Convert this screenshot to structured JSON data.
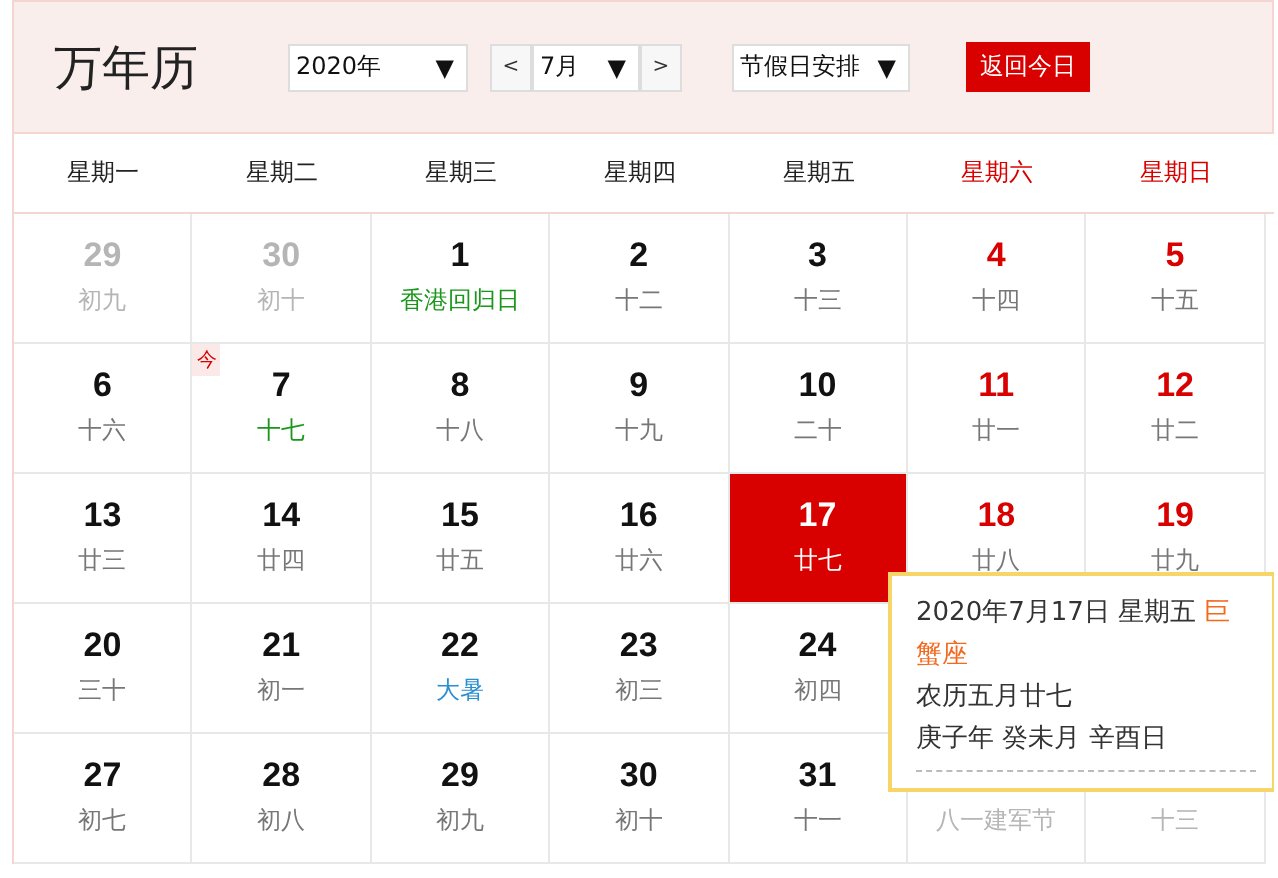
{
  "header": {
    "title": "万年历",
    "year_select": "2020年",
    "prev": "<",
    "month_select": "7月",
    "next": ">",
    "holiday_select": "节假日安排",
    "today_button": "返回今日",
    "caret": "▼"
  },
  "weekdays": [
    {
      "label": "星期一",
      "weekend": false
    },
    {
      "label": "星期二",
      "weekend": false
    },
    {
      "label": "星期三",
      "weekend": false
    },
    {
      "label": "星期四",
      "weekend": false
    },
    {
      "label": "星期五",
      "weekend": false
    },
    {
      "label": "星期六",
      "weekend": true
    },
    {
      "label": "星期日",
      "weekend": true
    }
  ],
  "weeks": [
    [
      {
        "day": "29",
        "sub": "初九",
        "other_month": true,
        "selected": false
      },
      {
        "day": "30",
        "sub": "初十",
        "other_month": true,
        "selected": false
      },
      {
        "day": "1",
        "sub": "香港回归日",
        "kind": "festival",
        "other_month": false,
        "weekend": false,
        "selected": false
      },
      {
        "day": "2",
        "sub": "十二",
        "kind": "lunar",
        "other_month": false,
        "weekend": false,
        "selected": false
      },
      {
        "day": "3",
        "sub": "十三",
        "kind": "lunar",
        "other_month": false,
        "weekend": false,
        "selected": false
      },
      {
        "day": "4",
        "sub": "十四",
        "kind": "lunar",
        "other_month": false,
        "weekend": true,
        "selected": false
      },
      {
        "day": "5",
        "sub": "十五",
        "kind": "lunar",
        "other_month": false,
        "weekend": true,
        "selected": false
      }
    ],
    [
      {
        "day": "6",
        "sub": "十六",
        "kind": "lunar",
        "other_month": false,
        "weekend": false,
        "selected": false
      },
      {
        "day": "7",
        "sub": "十七",
        "kind": "lunar",
        "other_month": false,
        "weekend": false,
        "today": true,
        "badge": "今",
        "selected": false
      },
      {
        "day": "8",
        "sub": "十八",
        "kind": "lunar",
        "other_month": false,
        "weekend": false,
        "selected": false
      },
      {
        "day": "9",
        "sub": "十九",
        "kind": "lunar",
        "other_month": false,
        "weekend": false,
        "selected": false
      },
      {
        "day": "10",
        "sub": "二十",
        "kind": "lunar",
        "other_month": false,
        "weekend": false,
        "selected": false
      },
      {
        "day": "11",
        "sub": "廿一",
        "kind": "lunar",
        "other_month": false,
        "weekend": true,
        "selected": false
      },
      {
        "day": "12",
        "sub": "廿二",
        "kind": "lunar",
        "other_month": false,
        "weekend": true,
        "selected": false
      }
    ],
    [
      {
        "day": "13",
        "sub": "廿三",
        "kind": "lunar",
        "other_month": false,
        "weekend": false,
        "selected": false
      },
      {
        "day": "14",
        "sub": "廿四",
        "kind": "lunar",
        "other_month": false,
        "weekend": false,
        "selected": false
      },
      {
        "day": "15",
        "sub": "廿五",
        "kind": "lunar",
        "other_month": false,
        "weekend": false,
        "selected": false
      },
      {
        "day": "16",
        "sub": "廿六",
        "kind": "lunar",
        "other_month": false,
        "weekend": false,
        "selected": false
      },
      {
        "day": "17",
        "sub": "廿七",
        "selected": true
      },
      {
        "day": "18",
        "sub": "廿八",
        "kind": "lunar",
        "other_month": false,
        "weekend": true,
        "selected": false
      },
      {
        "day": "19",
        "sub": "廿九",
        "kind": "lunar",
        "other_month": false,
        "weekend": true,
        "selected": false
      }
    ],
    [
      {
        "day": "20",
        "sub": "三十",
        "kind": "lunar",
        "other_month": false,
        "weekend": false,
        "selected": false
      },
      {
        "day": "21",
        "sub": "初一",
        "kind": "lunar",
        "other_month": false,
        "weekend": false,
        "selected": false
      },
      {
        "day": "22",
        "sub": "大暑",
        "kind": "term",
        "other_month": false,
        "weekend": false,
        "selected": false
      },
      {
        "day": "23",
        "sub": "初三",
        "kind": "lunar",
        "other_month": false,
        "weekend": false,
        "selected": false
      },
      {
        "day": "24",
        "sub": "初四",
        "kind": "lunar",
        "other_month": false,
        "weekend": false,
        "selected": false
      }
    ],
    [
      {
        "day": "27",
        "sub": "初七",
        "kind": "lunar",
        "other_month": false,
        "weekend": false,
        "selected": false
      },
      {
        "day": "28",
        "sub": "初八",
        "kind": "lunar",
        "other_month": false,
        "weekend": false,
        "selected": false
      },
      {
        "day": "29",
        "sub": "初九",
        "kind": "lunar",
        "other_month": false,
        "weekend": false,
        "selected": false
      },
      {
        "day": "30",
        "sub": "初十",
        "kind": "lunar",
        "other_month": false,
        "weekend": false,
        "selected": false
      },
      {
        "day": "31",
        "sub": "十一",
        "kind": "lunar",
        "other_month": false,
        "weekend": false,
        "selected": false
      },
      {
        "sub": "八一建军节",
        "other_month": true,
        "selected": false
      },
      {
        "sub": "十三",
        "other_month": true,
        "selected": false
      }
    ]
  ],
  "popup": {
    "date": "2020年7月17日 星期五",
    "constellation": "巨蟹座",
    "lunar": "农历五月廿七",
    "ganzhi": "庚子年 癸未月 辛酉日"
  }
}
